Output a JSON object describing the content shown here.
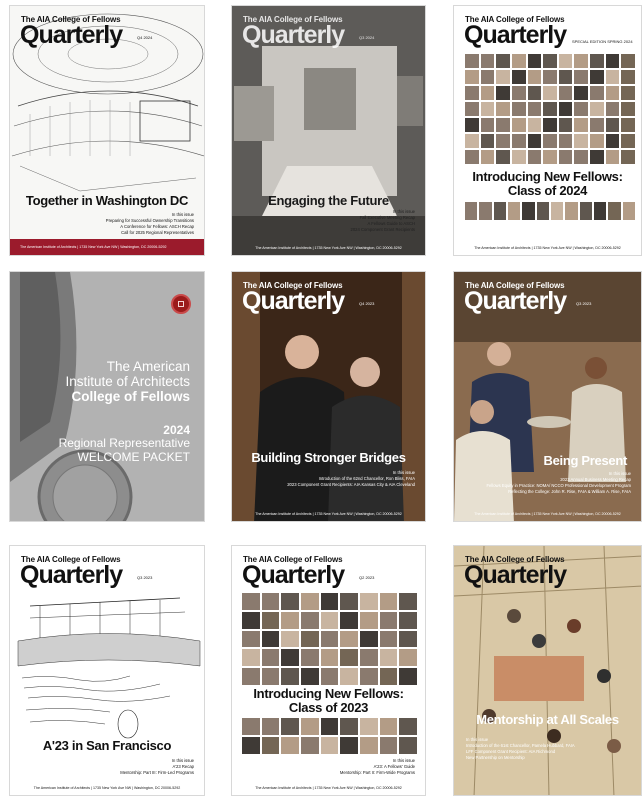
{
  "covers": [
    {
      "masthead_small": "The AIA College of Fellows",
      "masthead_big": "Quarterly",
      "issue": "Q4 2024",
      "headline": "Together in Washington DC",
      "in_this_issue_label": "In this issue",
      "items": [
        "Preparing for Successful Ownership Transitions",
        "A Conference for Fellows: ASCH Recap",
        "Call for 2025 Regional Representatives"
      ],
      "footer": "The American Institute of Architects  |  1735 New York Ave NW  |  Washington, DC 20006-5292",
      "footer_color": "#9b1b2c"
    },
    {
      "masthead_small": "The AIA College of Fellows",
      "masthead_big": "Quarterly",
      "issue": "Q3 2024",
      "headline": "Engaging the Future",
      "in_this_issue_label": "In this issue",
      "items": [
        "Fall Executive Meeting Recap",
        "A Fellows Guide to ASCH",
        "2024 Component Grant Recipients"
      ],
      "footer": "The American Institute of Architects  |  1735 New York Ave NW  |  Washington, DC 20006-5292"
    },
    {
      "masthead_small": "The AIA College of Fellows",
      "masthead_big": "Quarterly",
      "issue": "SPECIAL EDITION  SPRING 2024",
      "headline_line1": "Introducing New Fellows:",
      "headline_line2": "Class of 2024",
      "footer": "The American Institute of Architects  |  1735 New York Ave NW  |  Washington, DC 20006-5292"
    },
    {
      "title_line1": "The American",
      "title_line2": "Institute of Architects",
      "title_line3": "College of Fellows",
      "year": "2024",
      "sub_line1": "Regional Representative",
      "sub_line2": "WELCOME PACKET"
    },
    {
      "masthead_small": "The AIA College of Fellows",
      "masthead_big": "Quarterly",
      "issue": "Q4 2023",
      "headline": "Building Stronger Bridges",
      "in_this_issue_label": "In this issue",
      "items": [
        "Introduction of the 62nd Chancellor, Ron Bliss, FAIA",
        "2023 Component Grant Recipients: AIA Kansas City & AIA Cleveland"
      ],
      "footer": "The American Institute of Architects  |  1735 New York Ave NW  |  Washington, DC 20006-5292"
    },
    {
      "masthead_small": "The AIA College of Fellows",
      "masthead_big": "Quarterly",
      "issue": "Q3 2023",
      "headline": "Being Present",
      "in_this_issue_label": "In this issue",
      "items": [
        "2023 Annual Business Meeting Recap",
        "Fellows Equity in Practice: NOMA/ NCCO Professional Development Program",
        "Reflecting the College: John R. Rise, FAIA & William A. Rise, FAIA"
      ],
      "footer": "The American Institute of Architects  |  1735 New York Ave NW  |  Washington, DC 20006-5292"
    },
    {
      "masthead_small": "The AIA College of Fellows",
      "masthead_big": "Quarterly",
      "issue": "Q3 2023",
      "headline": "A'23 in San Francisco",
      "in_this_issue_label": "In this issue",
      "items": [
        "A'23 Recap",
        "Mentorship: Part III: Firm-Led Programs"
      ],
      "footer": "The American Institute of Architects  |  1735 New York Ave NW  |  Washington, DC 20006-5292"
    },
    {
      "masthead_small": "The AIA College of Fellows",
      "masthead_big": "Quarterly",
      "issue": "Q2 2023",
      "headline_line1": "Introducing New Fellows:",
      "headline_line2": "Class of 2023",
      "in_this_issue_label": "In this issue",
      "items": [
        "A'23: A Fellows' Guide",
        "Mentorship: Part II: Firm-Wide Programs"
      ],
      "footer": "The American Institute of Architects  |  1735 New York Ave NW  |  Washington, DC 20006-5292"
    },
    {
      "masthead_small": "The AIA College of Fellows",
      "masthead_big": "Quarterly",
      "headline": "Mentorship at All Scales",
      "in_this_issue_label": "In this issue",
      "items": [
        "Introduction of the 61st Chancellor, Pamela Hubbard, FAIA",
        "LFF Component Grant Recipient: AIA Richmond",
        "New Partnership on Mentorship"
      ]
    }
  ]
}
